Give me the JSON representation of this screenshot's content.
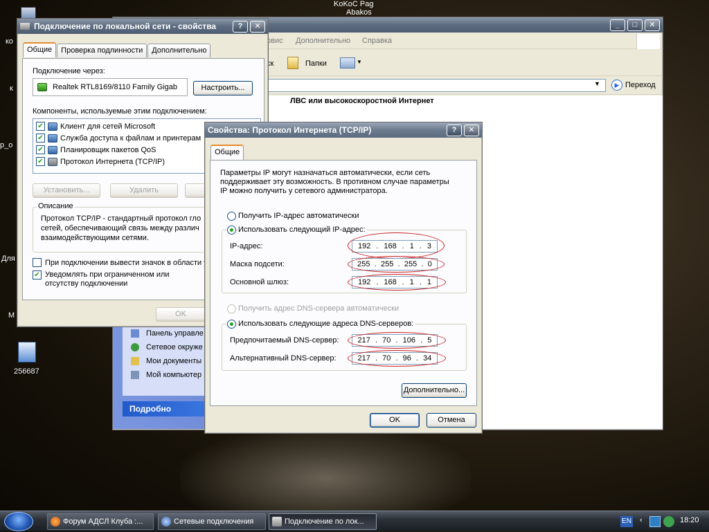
{
  "desktop": {
    "icons": [
      {
        "label": "ко"
      },
      {
        "label": "к"
      },
      {
        "label": "р_о"
      },
      {
        "label": "Для"
      },
      {
        "label": "М"
      },
      {
        "label": "256687"
      }
    ],
    "overlay_top": [
      "KoKoC Pag",
      "Abakos"
    ]
  },
  "lan_props": {
    "title": "Подключение по локальной сети - свойства",
    "tabs": [
      "Общие",
      "Проверка подлинности",
      "Дополнительно"
    ],
    "connect_via_label": "Подключение через:",
    "adapter": "Realtek RTL8169/8110 Family Gigab",
    "configure_button": "Настроить...",
    "components_label": "Компоненты, используемые этим подключением:",
    "components": [
      "Клиент для сетей Microsoft",
      "Служба доступа к файлам и принтерам",
      "Планировщик пакетов QoS",
      "Протокол Интернета (TCP/IP)"
    ],
    "install_button": "Установить...",
    "remove_button": "Удалить",
    "description_title": "Описание",
    "description_text": "Протокол TCP/IP - стандартный протокол гло сетей, обеспечивающий связь между различ взаимодействующими сетями.",
    "show_icon_label": "При подключении вывести значок в области у",
    "notify_label": "Уведомлять при ограниченном или отсутству подключении",
    "ok_button": "OK"
  },
  "explorer": {
    "menu": [
      "рвис",
      "Дополнительно",
      "Справка"
    ],
    "toolbar": {
      "search_tail": "ск",
      "folders": "Папки"
    },
    "go_button": "Переход",
    "section_header": "ЛВС или высокоскоростной Интернет",
    "side_links": [
      "Панель управле",
      "Сетевое окруже",
      "Мои документы",
      "Мой компьютер"
    ],
    "details_header": "Подробно"
  },
  "tcpip": {
    "title": "Свойства: Протокол Интернета (TCP/IP)",
    "tab": "Общие",
    "intro": [
      "Параметры IP могут назначаться автоматически, если сеть",
      "поддерживает эту возможность. В противном случае параметры",
      "IP можно получить у сетевого администратора."
    ],
    "auto_ip_label": "Получить IP-адрес автоматически",
    "manual_ip_label": "Использовать следующий IP-адрес:",
    "ip_label": "IP-адрес:",
    "ip_value": [
      "192",
      "168",
      "1",
      "3"
    ],
    "mask_label": "Маска подсети:",
    "mask_value": [
      "255",
      "255",
      "255",
      "0"
    ],
    "gateway_label": "Основной шлюз:",
    "gateway_value": [
      "192",
      "168",
      "1",
      "1"
    ],
    "auto_dns_label": "Получить адрес DNS-сервера автоматически",
    "manual_dns_label": "Использовать следующие адреса DNS-серверов:",
    "pref_dns_label": "Предпочитаемый DNS-сервер:",
    "pref_dns_value": [
      "217",
      "70",
      "106",
      "5"
    ],
    "alt_dns_label": "Альтернативный DNS-сервер:",
    "alt_dns_value": [
      "217",
      "70",
      "96",
      "34"
    ],
    "advanced_button": "Дополнительно...",
    "ok_button": "OK",
    "cancel_button": "Отмена"
  },
  "taskbar": {
    "tasks": [
      "Форум АДСЛ Клуба :...",
      "Сетевые подключения",
      "Подключение по лок..."
    ],
    "lang": "EN",
    "time": "18:20"
  }
}
